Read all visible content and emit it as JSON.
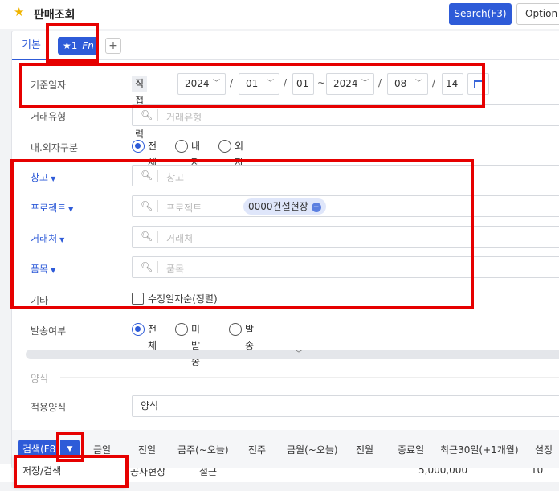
{
  "header": {
    "title": "판매조회",
    "search_button": "Search(F3)",
    "option_button": "Option"
  },
  "tabs": {
    "basic": "기본",
    "fn_index": "★1",
    "fn_label": "Fn",
    "add": "+"
  },
  "form": {
    "base_date": {
      "label": "기준일자",
      "mode": "직접입력",
      "from_year": "2024",
      "from_month": "01",
      "from_day": "01",
      "range_sep": "~",
      "to_year": "2024",
      "to_month": "08",
      "to_day": "14",
      "date_sep": "/"
    },
    "trade_type": {
      "label": "거래유형",
      "placeholder": "거래유형"
    },
    "domestic": {
      "label": "내.외자구분",
      "options": [
        "전체",
        "내자",
        "외자"
      ],
      "selected": "전체"
    },
    "warehouse": {
      "label": "창고",
      "placeholder": "창고"
    },
    "project": {
      "label": "프로젝트",
      "placeholder": "프로젝트",
      "chip": "0000건설현장"
    },
    "customer": {
      "label": "거래처",
      "placeholder": "거래처"
    },
    "item": {
      "label": "품목",
      "placeholder": "품목"
    },
    "etc": {
      "label": "기타",
      "checkbox": "수정일자순(정렬)",
      "checked": false
    },
    "send_status": {
      "label": "발송여부",
      "options": [
        "전체",
        "미발송",
        "발송"
      ],
      "selected": "전체"
    }
  },
  "style_section": {
    "title": "양식",
    "label": "적용양식",
    "value": "양식"
  },
  "bottom": {
    "search": "검색(F8)",
    "quick": [
      "금일",
      "전일",
      "금주(~오늘)",
      "전주",
      "금월(~오늘)",
      "전월",
      "종료일",
      "최근30일(+1개월)",
      "설정"
    ]
  },
  "dropdown": {
    "item": "저장/검색"
  },
  "background_row": {
    "c1": "공사현장",
    "c2": "철근",
    "amount": "5,000,000",
    "qty": "10"
  },
  "colors": {
    "accent": "#2e5bd8",
    "highlight": "#e60000",
    "star": "#f0b400"
  }
}
